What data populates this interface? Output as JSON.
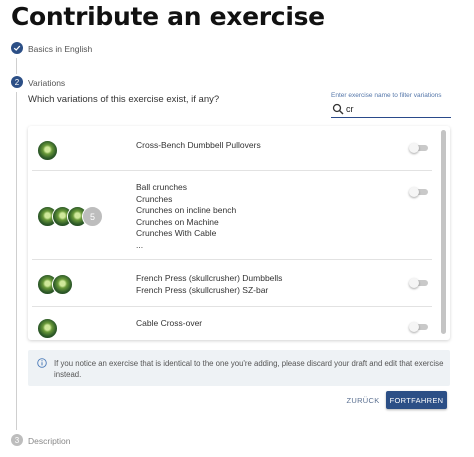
{
  "page_title": "Contribute an exercise",
  "steps": [
    {
      "label": "Basics in English",
      "status": "completed",
      "icon": "check-icon"
    },
    {
      "label": "Variations",
      "status": "active",
      "number": "2"
    },
    {
      "label": "Description",
      "status": "pending",
      "number": "3"
    }
  ],
  "variations": {
    "question": "Which variations of this exercise exist, if any?",
    "filter_label": "Enter exercise name to filter variations",
    "filter_value": "cr",
    "groups": [
      {
        "names": [
          "Cross-Bench Dumbbell Pullovers"
        ],
        "avatar_count": 1,
        "more_count": "",
        "toggle_on": false
      },
      {
        "names": [
          "Ball crunches",
          "Crunches",
          "Crunches on incline bench",
          "Crunches on Machine",
          "Crunches With Cable",
          "..."
        ],
        "avatar_count": 3,
        "more_count": "5",
        "toggle_on": false
      },
      {
        "names": [
          "French Press (skullcrusher) Dumbbells",
          "French Press (skullcrusher) SZ-bar"
        ],
        "avatar_count": 2,
        "more_count": "",
        "toggle_on": false
      },
      {
        "names": [
          "Cable Cross-over"
        ],
        "avatar_count": 1,
        "more_count": "",
        "toggle_on": false
      }
    ],
    "info_text": "If you notice an exercise that is identical to the one you're adding, please discard your draft and edit that exercise instead."
  },
  "buttons": {
    "back": "ZURÜCK",
    "next": "FORTFAHREN"
  },
  "colors": {
    "accent": "#2c4f86",
    "info_bg": "#eef2f5",
    "link": "#5577aa"
  }
}
